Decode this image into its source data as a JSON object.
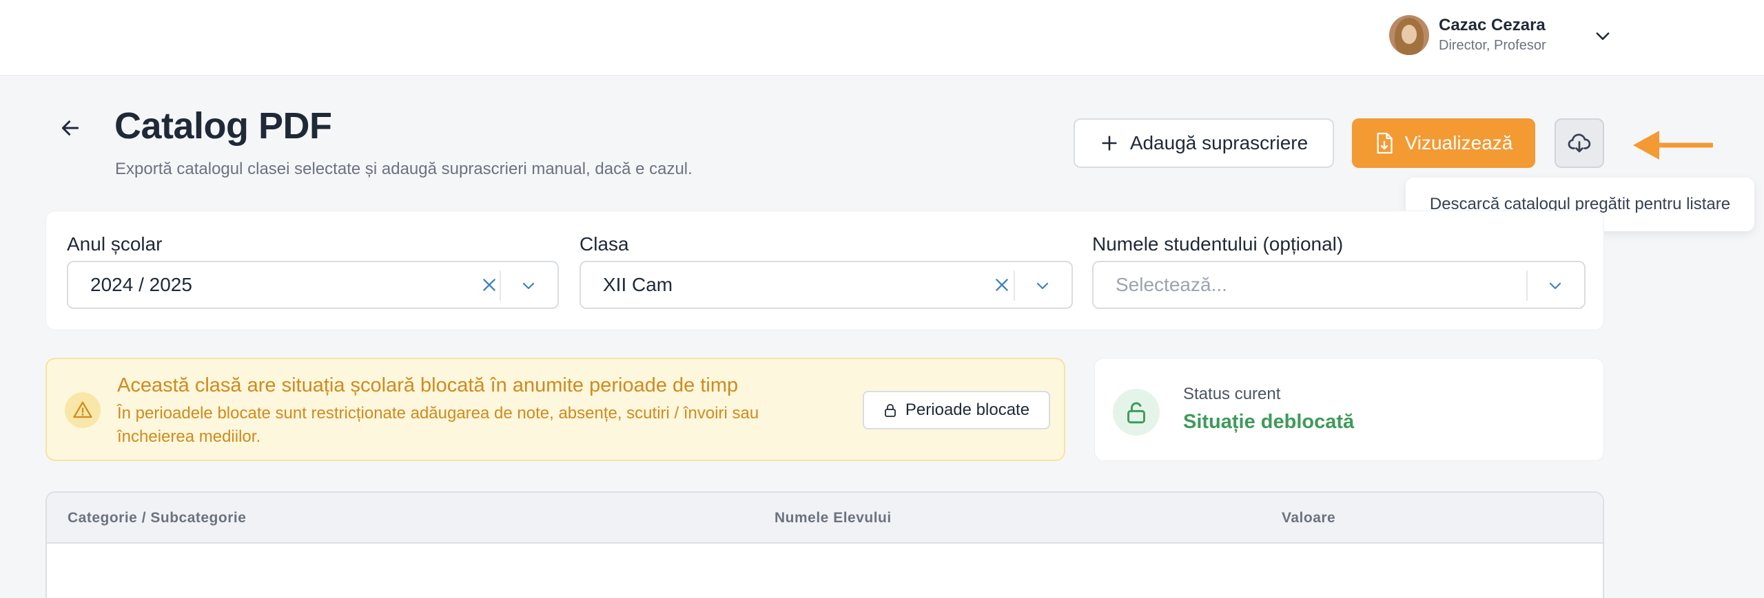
{
  "user": {
    "name": "Cazac Cezara",
    "role": "Director, Profesor"
  },
  "page": {
    "title": "Catalog PDF",
    "subtitle": "Exportă catalogul clasei selectate și adaugă suprascrieri manual, dacă e cazul."
  },
  "actions": {
    "add_override_label": "Adaugă suprascriere",
    "preview_label": "Vizualizează",
    "download_tooltip": "Descarcă catalogul pregătit pentru listare"
  },
  "filters": {
    "year": {
      "label": "Anul școlar",
      "value": "2024 / 2025"
    },
    "class": {
      "label": "Clasa",
      "value": "XII Cam"
    },
    "student": {
      "label": "Numele studentului (opțional)",
      "placeholder": "Selectează..."
    }
  },
  "warning": {
    "title": "Această clasă are situația școlară blocată în anumite perioade de timp",
    "text": "În perioadele blocate sunt restricționate adăugarea de note, absențe, scutiri / învoiri sau încheierea mediilor.",
    "button_label": "Perioade blocate"
  },
  "status": {
    "label": "Status curent",
    "value": "Situație deblocată"
  },
  "table": {
    "columns": [
      "Categorie / Subcategorie",
      "Numele Elevului",
      "Valoare"
    ]
  },
  "colors": {
    "accent": "#f39a33",
    "success": "#3f9a5a",
    "warning_text": "#d08a1c"
  }
}
